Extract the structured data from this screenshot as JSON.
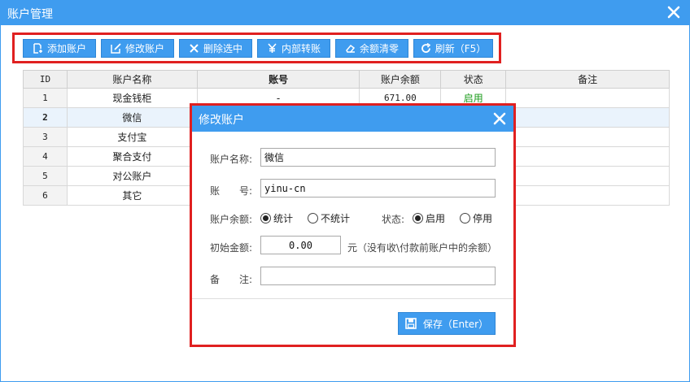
{
  "window": {
    "title": "账户管理"
  },
  "toolbar": {
    "add_label": "添加账户",
    "edit_label": "修改账户",
    "delete_label": "删除选中",
    "transfer_label": "内部转账",
    "clear_label": "余额清零",
    "refresh_label": "刷新（F5）"
  },
  "table": {
    "headers": {
      "id": "ID",
      "name": "账户名称",
      "account": "账号",
      "balance": "账户余额",
      "status": "状态",
      "note": "备注"
    },
    "rows": [
      {
        "id": "1",
        "name": "现金钱柜",
        "account": "-",
        "balance": "671.00",
        "status": "启用",
        "note": ""
      },
      {
        "id": "2",
        "name": "微信",
        "account": "",
        "balance": "",
        "status": "",
        "note": ""
      },
      {
        "id": "3",
        "name": "支付宝",
        "account": "",
        "balance": "",
        "status": "",
        "note": ""
      },
      {
        "id": "4",
        "name": "聚合支付",
        "account": "",
        "balance": "",
        "status": "",
        "note": ""
      },
      {
        "id": "5",
        "name": "对公账户",
        "account": "",
        "balance": "",
        "status": "",
        "note": ""
      },
      {
        "id": "6",
        "name": "其它",
        "account": "",
        "balance": "",
        "status": "",
        "note": ""
      }
    ]
  },
  "dialog": {
    "title": "修改账户",
    "name_label": "账户名称:",
    "name_value": "微信",
    "account_label_a": "账",
    "account_label_b": "号:",
    "account_value": "yinu-cn",
    "balance_label": "账户余额:",
    "balance_opt_count": "统计",
    "balance_opt_nocount": "不统计",
    "status_label": "状态:",
    "status_opt_on": "启用",
    "status_opt_off": "停用",
    "initial_label": "初始金额:",
    "initial_value": "0.00",
    "initial_hint": "元（没有收\\付款前账户中的余额）",
    "note_label_a": "备",
    "note_label_b": "注:",
    "note_value": "",
    "save_label": "保存（Enter）"
  },
  "colors": {
    "accent": "#3f9cef",
    "highlight_frame": "#e02020",
    "status_on": "#1a9b1a"
  }
}
